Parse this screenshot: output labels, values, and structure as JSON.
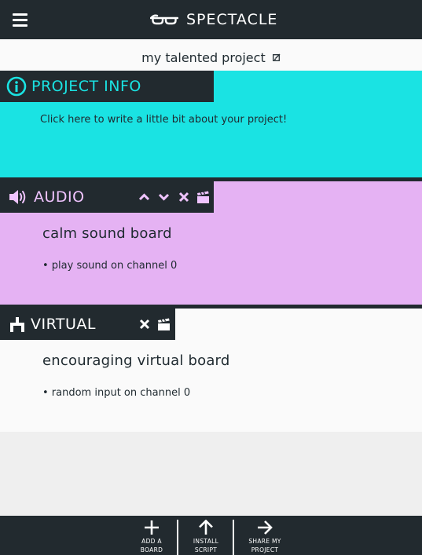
{
  "header": {
    "app_title": "SPECTACLE",
    "menu_icon": "hamburger-menu-icon",
    "logo_icon": "spectacles-logo-icon"
  },
  "project": {
    "name": "my talented project",
    "edit_icon": "edit-pencil-icon"
  },
  "project_info": {
    "title": "PROJECT INFO",
    "icon": "info-circle-icon",
    "placeholder": "Click here to write a little bit about your project!",
    "color": "#1ae3e3"
  },
  "boards": [
    {
      "tab_label": "AUDIO",
      "icon": "speaker-icon",
      "board_name": "calm sound board",
      "action": "• play sound on channel 0",
      "color": "#e5b2f3",
      "accent": "#f0c4ff"
    },
    {
      "tab_label": "VIRTUAL",
      "icon": "joystick-icon",
      "board_name": "encouraging virtual board",
      "action": "• random input on channel 0",
      "color": "#fafafa",
      "accent": "#ffffff"
    }
  ],
  "footer": {
    "add_board": "ADD A BOARD",
    "install_script": "INSTALL SCRIPT",
    "share_project": "SHARE MY PROJECT"
  },
  "colors": {
    "dark": "#222a2f",
    "project_info_accent": "#1ae3e3",
    "background": "#efefef"
  }
}
